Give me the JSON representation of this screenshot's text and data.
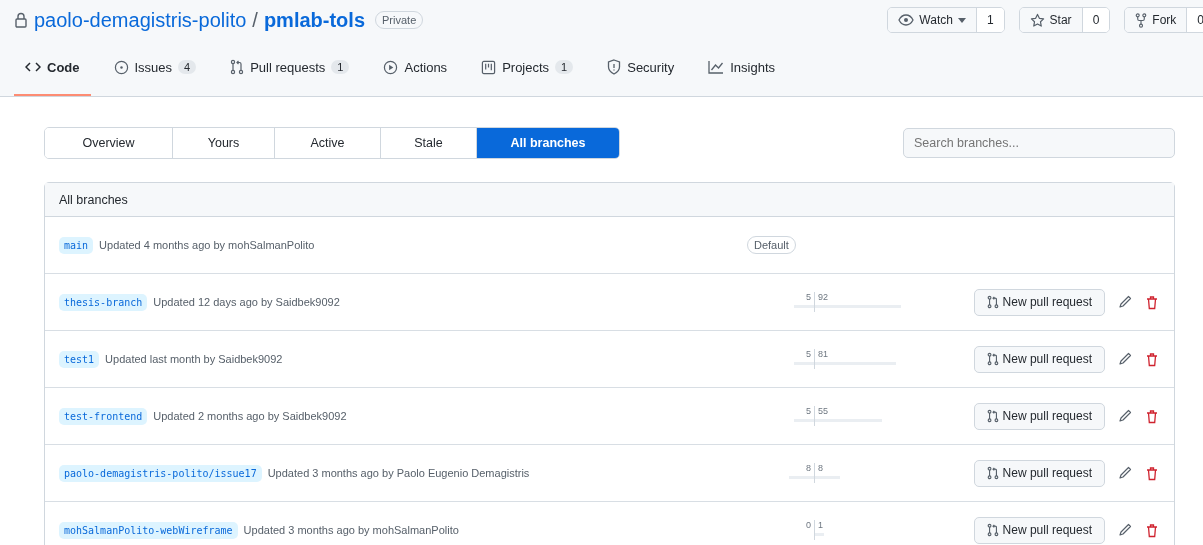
{
  "repo": {
    "owner": "paolo-demagistris-polito",
    "name": "pmlab-tols",
    "separator": "/",
    "visibility": "Private"
  },
  "actions": [
    {
      "kind": "watch",
      "label": "Watch",
      "count": "1"
    },
    {
      "kind": "star",
      "label": "Star",
      "count": "0"
    },
    {
      "kind": "fork",
      "label": "Fork",
      "count": "0"
    }
  ],
  "tabs": [
    {
      "kind": "code",
      "label": "Code",
      "selected": true
    },
    {
      "kind": "issues",
      "label": "Issues",
      "count": "4",
      "selected": false
    },
    {
      "kind": "pulls",
      "label": "Pull requests",
      "count": "1",
      "selected": false
    },
    {
      "kind": "actions",
      "label": "Actions",
      "selected": false
    },
    {
      "kind": "projects",
      "label": "Projects",
      "count": "1",
      "selected": false
    },
    {
      "kind": "security",
      "label": "Security",
      "selected": false
    },
    {
      "kind": "insights",
      "label": "Insights",
      "selected": false
    }
  ],
  "filters": [
    {
      "label": "Overview",
      "selected": false
    },
    {
      "label": "Yours",
      "selected": false
    },
    {
      "label": "Active",
      "selected": false
    },
    {
      "label": "Stale",
      "selected": false
    },
    {
      "label": "All branches",
      "selected": true
    }
  ],
  "search": {
    "placeholder": "Search branches..."
  },
  "list_title": "All branches",
  "branches": [
    {
      "name": "main",
      "updated": "Updated 4 months ago by mohSalmanPolito",
      "default_label": "Default"
    },
    {
      "name": "thesis-branch",
      "updated": "Updated 12 days ago by Saidbek9092",
      "behind": "5",
      "ahead": "92",
      "button": "New pull request"
    },
    {
      "name": "test1",
      "updated": "Updated last month by Saidbek9092",
      "behind": "5",
      "ahead": "81",
      "button": "New pull request"
    },
    {
      "name": "test-frontend",
      "updated": "Updated 2 months ago by Saidbek9092",
      "behind": "5",
      "ahead": "55",
      "button": "New pull request"
    },
    {
      "name": "paolo-demagistris-polito/issue17",
      "updated": "Updated 3 months ago by Paolo Eugenio Demagistris",
      "behind": "8",
      "ahead": "8",
      "button": "New pull request"
    },
    {
      "name": "mohSalmanPolito-webWireframe",
      "updated": "Updated 3 months ago by mohSalmanPolito",
      "behind": "0",
      "ahead": "1",
      "button": "New pull request"
    }
  ]
}
